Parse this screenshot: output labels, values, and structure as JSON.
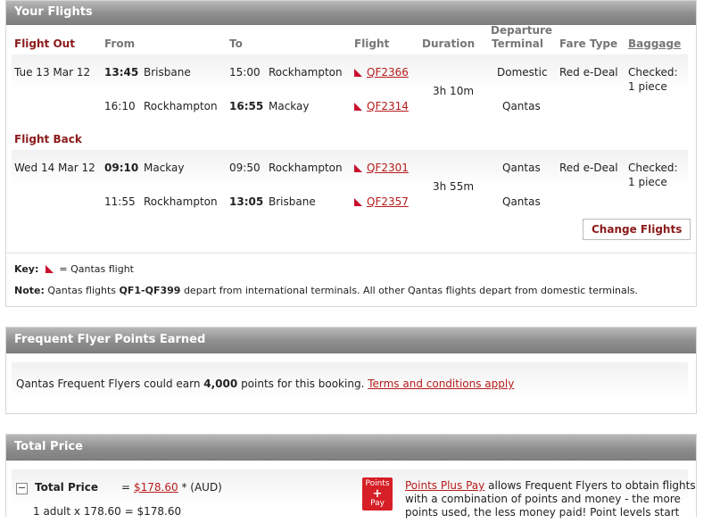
{
  "flights": {
    "title": "Your Flights",
    "headers": {
      "from": "From",
      "to": "To",
      "flight": "Flight",
      "duration": "Duration",
      "departure_terminal_1": "Departure",
      "departure_terminal_2": "Terminal",
      "fare_type": "Fare Type",
      "baggage": "Baggage"
    },
    "out": {
      "label": "Flight Out",
      "date": "Tue 13 Mar 12",
      "duration": "3h 10m",
      "fare": "Red e-Deal",
      "baggage_1": "Checked:",
      "baggage_2": "1 piece",
      "legs": [
        {
          "dep_time": "13:45",
          "from": "Brisbane",
          "arr_time": "15:00",
          "to": "Rockhampton",
          "flight": "QF2366",
          "terminal": "Domestic"
        },
        {
          "dep_time": "16:10",
          "from": "Rockhampton",
          "arr_time": "16:55",
          "to": "Mackay",
          "flight": "QF2314",
          "terminal": "Qantas"
        }
      ]
    },
    "back": {
      "label": "Flight Back",
      "date": "Wed 14 Mar 12",
      "duration": "3h 55m",
      "fare": "Red e-Deal",
      "baggage_1": "Checked:",
      "baggage_2": "1 piece",
      "legs": [
        {
          "dep_time": "09:10",
          "from": "Mackay",
          "arr_time": "09:50",
          "to": "Rockhampton",
          "flight": "QF2301",
          "terminal": "Qantas"
        },
        {
          "dep_time": "11:55",
          "from": "Rockhampton",
          "arr_time": "13:05",
          "to": "Brisbane",
          "flight": "QF2357",
          "terminal": "Qantas"
        }
      ]
    },
    "change_button": "Change Flights",
    "key_label": "Key:",
    "key_text": "= Qantas flight",
    "note_label": "Note:",
    "note_pre": "Qantas flights",
    "note_bold": "QF1-QF399",
    "note_post": "depart from international terminals. All other Qantas flights depart from domestic terminals."
  },
  "ff": {
    "title": "Frequent Flyer Points Earned",
    "text_pre": "Qantas Frequent Flyers could earn",
    "points": "4,000",
    "text_post": "points for this booking.",
    "terms_link": "Terms and conditions apply"
  },
  "total": {
    "title": "Total Price",
    "label": "Total Price",
    "eq": "=",
    "amount": "$178.60",
    "currency": "* (AUD)",
    "breakdown": "1 adult x 178.60 = $178.60",
    "ppp_badge_1": "Points",
    "ppp_badge_2": "+",
    "ppp_badge_3": "Pay",
    "ppp_link": "Points Plus Pay",
    "ppp_text_1": "allows Frequent Flyers to obtain flights",
    "ppp_text_2": "with a combination of points and money - the more",
    "ppp_text_3": "points used, the less money paid! Point levels start"
  },
  "colors": {
    "accent": "#8b1a1a",
    "link": "#b71c1c",
    "qantas_red": "#c8102e"
  }
}
